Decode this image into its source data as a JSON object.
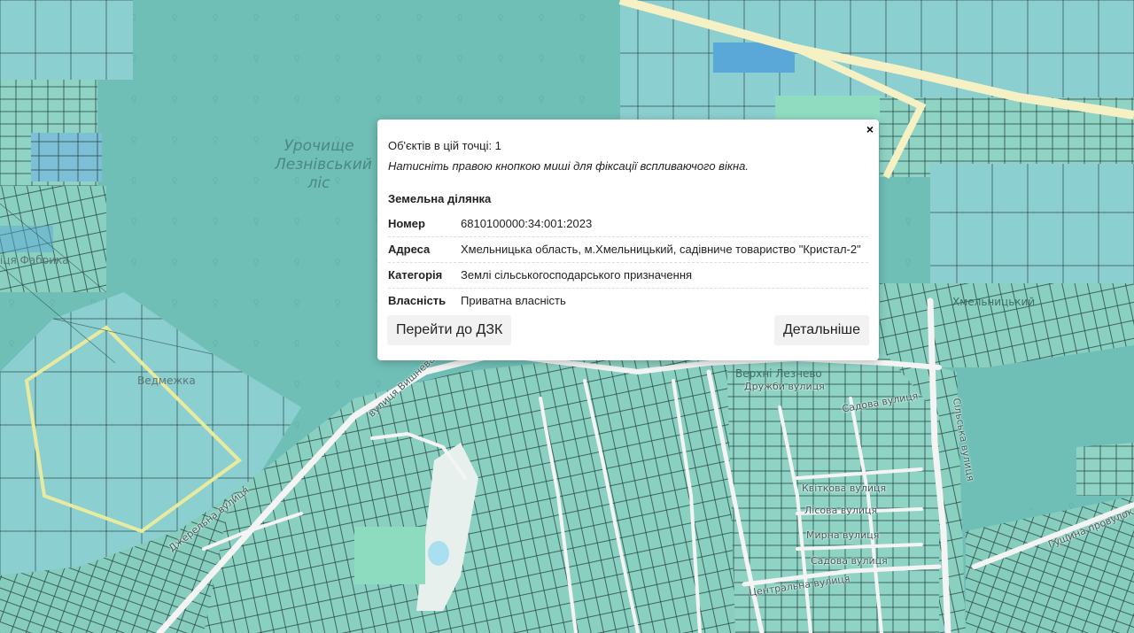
{
  "map": {
    "colors": {
      "forest": "#6fbfb7",
      "parcel": "#8fd3c4",
      "parcel_dark": "#70c0b0",
      "parcel_blue": "#74b9d4",
      "parcel_highlight": "#5aa8d8",
      "road": "#f4f4f4",
      "major_road": "#f6f1c4",
      "parcel_border": "#2a4a48"
    },
    "labels": {
      "forest_name_line1": "Урочище",
      "forest_name_line2": "Лезнівський",
      "forest_name_line3": "ліс",
      "place_vedmezhka": "Ведмежка",
      "place_fabryka": "іця Фабрика",
      "place_khmelnytskyi": "Хмельницький",
      "place_verkhni": "Верхні Лезнево",
      "street_sadova": "Садова вулиця",
      "street_dzherelna": "Джерельна вулиця",
      "street_tsentralna": "Центральна вулиця",
      "street_kvitkova": "Квіткова вулиця",
      "street_lisova": "Лісова вулиця",
      "street_myrna": "Мирна вулиця",
      "street_druzhby": "Дружби вулиця",
      "street_sadova2": "Садова вулиця",
      "street_gushchina": "Гущина провулок",
      "street_vyshneva": "вулиця Вишнева",
      "street_lisna": "Сільська вулиця"
    }
  },
  "popup": {
    "close_label": "×",
    "objects_count": "Об'єктів в цій точці: 1",
    "hint": "Натисніть правою кнопкою миші для фіксації вспливаючого вікна.",
    "section_title": "Земельна ділянка",
    "rows": [
      {
        "key": "Номер",
        "value": "6810100000:34:001:2023"
      },
      {
        "key": "Адреса",
        "value": "Хмельницька область, м.Хмельницький, садівниче товариство \"Кристал-2\""
      },
      {
        "key": "Категорія",
        "value": "Землі сільськогосподарського призначення"
      },
      {
        "key": "Власність",
        "value": "Приватна власність"
      }
    ],
    "btn_dzk": "Перейти до ДЗК",
    "btn_more": "Детальніше"
  }
}
